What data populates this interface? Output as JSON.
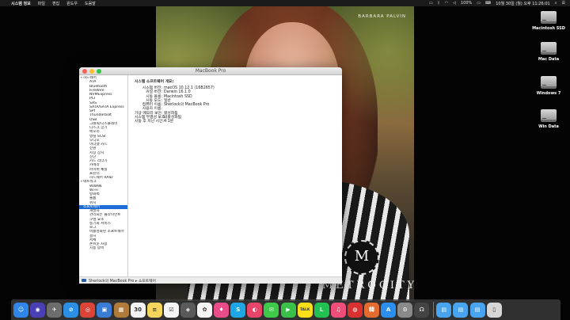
{
  "menubar": {
    "apple": "",
    "items": [
      "시스템 정보",
      "파일",
      "편집",
      "윈도우",
      "도움말"
    ],
    "battery": "100%",
    "datetime": "10월 30일 (월) 오후 11:26:01",
    "status_icons": [
      "airplay-icon",
      "bluetooth-icon",
      "wifi-icon",
      "volume-icon",
      "battery-icon",
      "input-source-icon",
      "spotlight-icon",
      "notification-icon"
    ]
  },
  "wallpaper": {
    "caption": "BARBARA PALVIN",
    "emblem": "M",
    "logo": "METROCITY"
  },
  "desktop": {
    "disks": [
      {
        "label": "Macintosh SSD"
      },
      {
        "label": "Mac Data"
      },
      {
        "label": "Windows 7"
      },
      {
        "label": "Win Data"
      }
    ]
  },
  "window": {
    "title": "MacBook Pro",
    "sidebar": [
      {
        "label": "하드웨어",
        "kind": "section"
      },
      {
        "label": "ATA",
        "kind": "item"
      },
      {
        "label": "Bluetooth",
        "kind": "item"
      },
      {
        "label": "FireWire",
        "kind": "item"
      },
      {
        "label": "NVMExpress",
        "kind": "item"
      },
      {
        "label": "PCI",
        "kind": "item"
      },
      {
        "label": "SAS",
        "kind": "item"
      },
      {
        "label": "SATA/SATA Express",
        "kind": "item"
      },
      {
        "label": "SPI",
        "kind": "item"
      },
      {
        "label": "Thunderbolt",
        "kind": "item"
      },
      {
        "label": "USB",
        "kind": "item"
      },
      {
        "label": "그래픽/디스플레이",
        "kind": "item"
      },
      {
        "label": "디스크 굽기",
        "kind": "item"
      },
      {
        "label": "메모리",
        "kind": "item"
      },
      {
        "label": "병렬 SCSI",
        "kind": "item"
      },
      {
        "label": "오디오",
        "kind": "item"
      },
      {
        "label": "이더넷 카드",
        "kind": "item"
      },
      {
        "label": "전원",
        "kind": "item"
      },
      {
        "label": "저장 장치",
        "kind": "item"
      },
      {
        "label": "진단",
        "kind": "item"
      },
      {
        "label": "카드 리더기",
        "kind": "item"
      },
      {
        "label": "카메라",
        "kind": "item"
      },
      {
        "label": "파이버 채널",
        "kind": "item"
      },
      {
        "label": "프린터",
        "kind": "item"
      },
      {
        "label": "하드웨어 RAID",
        "kind": "item"
      },
      {
        "label": "네트워크",
        "kind": "section"
      },
      {
        "label": "WWAN",
        "kind": "item"
      },
      {
        "label": "Wi-Fi",
        "kind": "item"
      },
      {
        "label": "방화벽",
        "kind": "item"
      },
      {
        "label": "볼륨",
        "kind": "item"
      },
      {
        "label": "위치",
        "kind": "item"
      },
      {
        "label": "소프트웨어",
        "kind": "section",
        "selected": true
      },
      {
        "label": "개발자",
        "kind": "item"
      },
      {
        "label": "관리되는 클라이언트",
        "kind": "item"
      },
      {
        "label": "구성 요소",
        "kind": "item"
      },
      {
        "label": "동기화 서비스",
        "kind": "item"
      },
      {
        "label": "로그",
        "kind": "item"
      },
      {
        "label": "비활성화된 소프트웨어",
        "kind": "item"
      },
      {
        "label": "설치",
        "kind": "item"
      },
      {
        "label": "서체",
        "kind": "item"
      },
      {
        "label": "손쉬운 사용",
        "kind": "item"
      },
      {
        "label": "시동 항목",
        "kind": "item"
      }
    ],
    "details": {
      "heading": "시스템 소프트웨어 개요:",
      "rows": [
        {
          "key": "시스템 버전:",
          "value": "macOS 10.12.1 (16B2657)"
        },
        {
          "key": "커널 버전:",
          "value": "Darwin 16.1.0"
        },
        {
          "key": "시동 볼륨:",
          "value": "Macintosh SSD"
        },
        {
          "key": "시동 모드:",
          "value": "일반"
        },
        {
          "key": "컴퓨터 이름:",
          "value": "Sherlock의 MacBook Pro"
        },
        {
          "key": "사용자 이름:",
          "value": ""
        },
        {
          "key": "가상 메모리 보안:",
          "value": "활성화됨"
        },
        {
          "key": "시스템 무결성 보호:",
          "value": "비활성화됨"
        },
        {
          "key": "시동 후 지난 시간:",
          "value": "4:1분"
        }
      ]
    },
    "pathbar": {
      "text": "Sherlock의 MacBook Pro  ▸  소프트웨어"
    }
  },
  "dock": {
    "apps": [
      {
        "name": "finder",
        "glyph": "☺",
        "color": "#2f86e8"
      },
      {
        "name": "siri",
        "glyph": "◉",
        "color": "#4b3fb4"
      },
      {
        "name": "launchpad",
        "glyph": "✈",
        "color": "#6d6d6d"
      },
      {
        "name": "safari",
        "glyph": "⊘",
        "color": "#2c8fe6"
      },
      {
        "name": "chrome",
        "glyph": "◎",
        "color": "#db4437"
      },
      {
        "name": "preview",
        "glyph": "▣",
        "color": "#3a7bd5"
      },
      {
        "name": "notefile",
        "glyph": "▦",
        "color": "#b07a3a"
      },
      {
        "name": "calendar",
        "glyph": "30",
        "color": "#f3f3f3"
      },
      {
        "name": "notes",
        "glyph": "≡",
        "color": "#f5d55b"
      },
      {
        "name": "reminders",
        "glyph": "☑",
        "color": "#f4f4f4"
      },
      {
        "name": "photo-booth",
        "glyph": "◈",
        "color": "#5a5a5a"
      },
      {
        "name": "photos",
        "glyph": "✿",
        "color": "#f4f4f4"
      },
      {
        "name": "itunes-store",
        "glyph": "♦",
        "color": "#ea4c89"
      },
      {
        "name": "skype",
        "glyph": "S",
        "color": "#1ea7e6"
      },
      {
        "name": "kakao-tv",
        "glyph": "◐",
        "color": "#e9456a"
      },
      {
        "name": "messages",
        "glyph": "✉",
        "color": "#3ec94b"
      },
      {
        "name": "facetime",
        "glyph": "▶",
        "color": "#3abf48"
      },
      {
        "name": "kakaotalk",
        "glyph": "TALK",
        "color": "#f9de1a"
      },
      {
        "name": "line",
        "glyph": "L",
        "color": "#21c252"
      },
      {
        "name": "itunes",
        "glyph": "♫",
        "color": "#ef4e7b"
      },
      {
        "name": "netease-music",
        "glyph": "◍",
        "color": "#d9312f"
      },
      {
        "name": "app-store-kr",
        "glyph": "韓",
        "color": "#e56b2e"
      },
      {
        "name": "app-store",
        "glyph": "A",
        "color": "#2b8ff0"
      },
      {
        "name": "system-preferences",
        "glyph": "⚙",
        "color": "#8a8a8a"
      },
      {
        "name": "console",
        "glyph": "☊",
        "color": "#444444"
      }
    ],
    "folders": [
      {
        "name": "downloads-folder",
        "glyph": "▤",
        "color": "#48a4ee"
      },
      {
        "name": "documents-folder",
        "glyph": "▤",
        "color": "#48a4ee"
      },
      {
        "name": "applications-folder",
        "glyph": "▤",
        "color": "#48a4ee"
      },
      {
        "name": "trash",
        "glyph": "▯",
        "color": "#d6d6d6"
      }
    ]
  }
}
